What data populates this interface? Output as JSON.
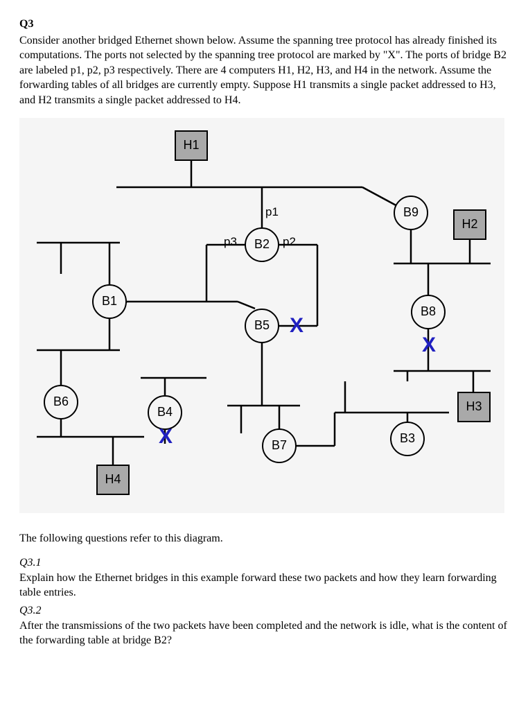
{
  "heading": "Q3",
  "intro": "Consider another bridged Ethernet shown below. Assume the spanning tree protocol has already finished its computations. The ports not selected by the spanning tree protocol are marked by \"X\".  The ports of bridge B2 are labeled p1, p2, p3 respectively. There are 4 computers H1, H2, H3, and H4 in the network. Assume the forwarding tables of all bridges are currently empty. Suppose H1 transmits a single packet addressed to H3, and H2 transmits a single packet addressed to H4.",
  "diagram": {
    "hosts": {
      "H1": "H1",
      "H2": "H2",
      "H3": "H3",
      "H4": "H4"
    },
    "bridges": {
      "B1": "B1",
      "B2": "B2",
      "B3": "B3",
      "B4": "B4",
      "B5": "B5",
      "B6": "B6",
      "B7": "B7",
      "B8": "B8",
      "B9": "B9"
    },
    "ports": {
      "p1": "p1",
      "p2": "p2",
      "p3": "p3"
    },
    "blocked_mark": "X"
  },
  "follow": "The following questions refer to this diagram.",
  "q31": {
    "title": "Q3.1",
    "text": "Explain how the Ethernet bridges in this example forward these two packets and how they learn forwarding table entries."
  },
  "q32": {
    "title": "Q3.2",
    "text": "After the transmissions of the two packets have been completed and the network is idle, what is the content of the forwarding table at bridge B2?"
  }
}
